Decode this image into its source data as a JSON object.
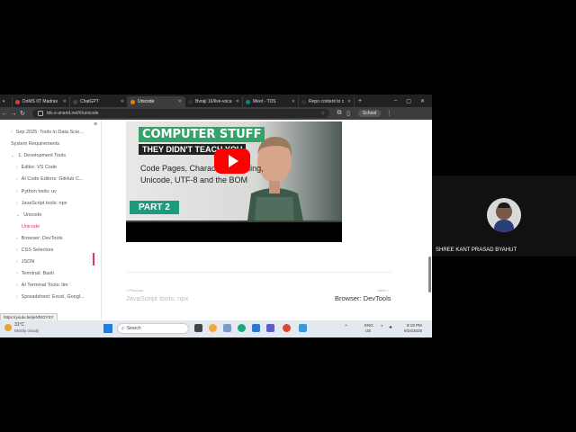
{
  "browser": {
    "tabs": [
      {
        "label": "DoMS IIT Madras",
        "active": false,
        "color": "#e53935"
      },
      {
        "label": "ChatGPT",
        "active": false,
        "color": "#444444"
      },
      {
        "label": "Unicode",
        "active": true,
        "color": "#f57c00"
      },
      {
        "label": "Bvraji 16/live-voca",
        "active": false,
        "color": "#333333"
      },
      {
        "label": "Meet - TDS",
        "active": false,
        "color": "#00897b"
      },
      {
        "label": "Repo content to c",
        "active": false,
        "color": "#333333"
      }
    ],
    "url": "tds.s-anand.net/#/unicode",
    "profile_label": "School"
  },
  "sidebar": {
    "items": [
      {
        "label": "Sep 2025: Tools in Data Scie...",
        "indent": 0,
        "chevron": "›"
      },
      {
        "label": "System Requirements",
        "indent": 0,
        "chevron": ""
      },
      {
        "label": "1. Development Tools",
        "indent": 0,
        "chevron": "⌄"
      },
      {
        "label": "Editor: VS Code",
        "indent": 1,
        "chevron": "›"
      },
      {
        "label": "AI Code Editors: GitHub C...",
        "indent": 1,
        "chevron": "›"
      },
      {
        "label": "Python tools: uv",
        "indent": 1,
        "chevron": "›"
      },
      {
        "label": "JavaScript tools: npx",
        "indent": 1,
        "chevron": "›"
      },
      {
        "label": "Unicode",
        "indent": 1,
        "chevron": "⌄"
      },
      {
        "label": "Unicode",
        "indent": 2,
        "chevron": "",
        "active": true
      },
      {
        "label": "Browser: DevTools",
        "indent": 1,
        "chevron": "›"
      },
      {
        "label": "CSS Selectors",
        "indent": 1,
        "chevron": "›"
      },
      {
        "label": "JSON",
        "indent": 1,
        "chevron": "›"
      },
      {
        "label": "Terminal: Bash",
        "indent": 1,
        "chevron": "›"
      },
      {
        "label": "AI Terminal Tools: llm",
        "indent": 1,
        "chevron": "›"
      },
      {
        "label": "Spreadsheet: Excel, Googl...",
        "indent": 1,
        "chevron": "›"
      }
    ],
    "accent": "#d63366"
  },
  "video": {
    "title": "COMPUTER STUFF",
    "subtitle": "THEY DIDN'T TEACH YOU",
    "line1": "Code Pages, Character Encoding,",
    "line2": "Unicode, UTF-8 and the BOM",
    "part": "PART 2"
  },
  "pager": {
    "prev_small": "« Previous",
    "prev_label": "JavaScript tools: npx",
    "next_small": "Next »",
    "next_label": "Browser: DevTools"
  },
  "link_status": "https://youtu.be/jeNfXGYSY",
  "taskbar": {
    "weather_temp": "31°C",
    "weather_desc": "Mostly cloudy",
    "search_placeholder": "Search",
    "lang1": "ENG",
    "lang2": "US",
    "time": "8:19 PM",
    "date": "9/24/2025"
  },
  "participant": {
    "name": "SHREE KANT PRASAD BYAHUT"
  }
}
